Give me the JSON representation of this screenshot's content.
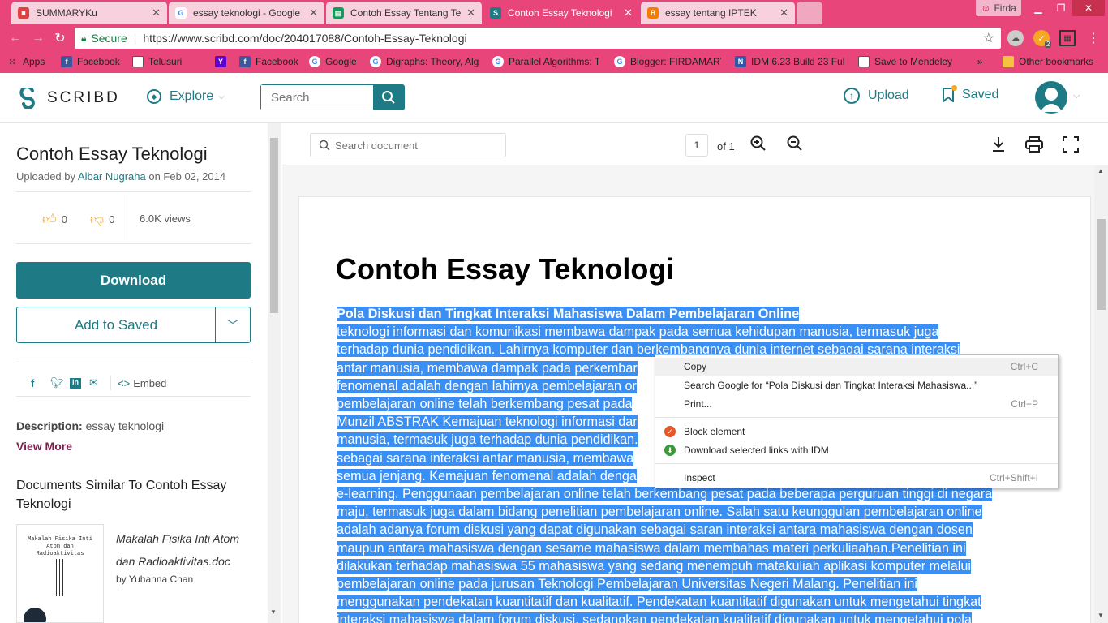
{
  "browser": {
    "tabs": [
      {
        "title": "SUMMARYKu",
        "favicon": "summary-icon",
        "active": false
      },
      {
        "title": "essay teknologi - Google",
        "favicon": "google-icon",
        "active": false
      },
      {
        "title": "Contoh Essay Tentang Te",
        "favicon": "google-sheets-icon",
        "active": false
      },
      {
        "title": "Contoh Essay Teknologi",
        "favicon": "scribd-icon",
        "active": true
      },
      {
        "title": "essay tentang IPTEK",
        "favicon": "blogger-icon",
        "active": false
      }
    ],
    "profile_name": "Firda",
    "secure_label": "Secure",
    "url": "https://www.scribd.com/doc/204017088/Contoh-Essay-Teknologi",
    "extension_badge": "2",
    "bookmarks": [
      {
        "label": "Apps",
        "icon": "apps-icon"
      },
      {
        "label": "Facebook",
        "icon": "facebook-icon"
      },
      {
        "label": "Telusuri",
        "icon": "page-icon"
      },
      {
        "label": "",
        "icon": "yahoo-icon"
      },
      {
        "label": "Facebook",
        "icon": "facebook-icon"
      },
      {
        "label": "Google",
        "icon": "google-icon"
      },
      {
        "label": "Digraphs: Theory, Alg",
        "icon": "google-icon"
      },
      {
        "label": "Parallel Algorithms: T",
        "icon": "google-icon"
      },
      {
        "label": "Blogger: FIRDAMARY",
        "icon": "google-icon"
      },
      {
        "label": "IDM 6.23 Build 23 Ful",
        "icon": "idm-icon"
      },
      {
        "label": "Save to Mendeley",
        "icon": "page-icon"
      }
    ],
    "more_bookmarks": "»",
    "other_bookmarks": "Other bookmarks"
  },
  "scribd": {
    "logo_text": "SCRIBD",
    "explore_label": "Explore",
    "search_placeholder": "Search",
    "upload_label": "Upload",
    "saved_label": "Saved"
  },
  "sidebar": {
    "title": "Contoh Essay Teknologi",
    "uploaded_prefix": "Uploaded by",
    "uploader": "Albar Nugraha",
    "uploaded_on": "on Feb 02, 2014",
    "likes": "0",
    "dislikes": "0",
    "views": "6.0K views",
    "download_label": "Download",
    "add_saved_label": "Add to Saved",
    "embed_label": "Embed",
    "description_label": "Description:",
    "description_value": "essay teknologi",
    "view_more": "View More",
    "similar_heading": "Documents Similar To Contoh Essay Teknologi",
    "similar_item": {
      "title": "Makalah Fisika Inti Atom dan Radioaktivitas.doc",
      "author": "by Yuhanna Chan",
      "thumb_title": "Makalah Fisika Inti Atom dan Radioaktivitas"
    }
  },
  "viewer": {
    "search_placeholder": "Search document",
    "page_number": "1",
    "page_total": "of 1",
    "doc_title": "Contoh Essay Teknologi",
    "lines": [
      "Pola Diskusi dan Tingkat Interaksi Mahasiswa Dalam Pembelajaran Online",
      " teknologi informasi dan komunikasi membawa dampak pada semua kehidupan manusia, termasuk juga",
      "terhadap dunia pendidikan. Lahirnya komputer dan berkembangnya dunia internet sebagai sarana interaksi",
      "antar manusia, membawa dampak pada perkembar",
      "fenomenal adalah dengan lahirnya pembelajaran or",
      "pembelajaran online telah berkembang pesat pada",
      "Munzil ABSTRAK Kemajuan teknologi informasi dar",
      "manusia, termasuk juga terhadap dunia pendidikan.",
      "sebagai sarana interaksi antar manusia, membawa",
      "semua jenjang. Kemajuan fenomenal adalah denga",
      "e-learning. Penggunaan pembelajaran online telah berkembang pesat pada beberapa perguruan tinggi di negara",
      "maju, termasuk juga dalam bidang penelitian pembelajaran online. Salah satu keunggulan pembelajaran online",
      "adalah adanya forum diskusi yang dapat digunakan sebagai saran interaksi antara mahasiswa dengan dosen",
      "maupun antara mahasiswa dengan sesame mahasiswa dalam membahas materi perkuliaahan.Penelitian ini",
      "dilakukan terhadap mahasiswa 55 mahasiswa yang sedang menempuh matakuliah aplikasi komputer melalui",
      "pembelajaran online pada jurusan Teknologi Pembelajaran Universitas Negeri Malang. Penelitian ini",
      "menggunakan pendekatan kuantitatif dan kualitatif. Pendekatan kuantitatif digunakan untuk mengetahui tingkat",
      "interaksi mahasiswa dalam forum diskusi, sedangkan pendekatan kualitatif digunakan untuk mengetahui pola"
    ]
  },
  "context_menu": {
    "items": [
      {
        "label": "Copy",
        "shortcut": "Ctrl+C"
      },
      {
        "label": "Search Google for “Pola Diskusi dan Tingkat Interaksi Mahasiswa...”",
        "shortcut": ""
      },
      {
        "label": "Print...",
        "shortcut": "Ctrl+P"
      },
      {
        "label": "Block element",
        "shortcut": ""
      },
      {
        "label": "Download selected links with IDM",
        "shortcut": ""
      },
      {
        "label": "Inspect",
        "shortcut": "Ctrl+Shift+I"
      }
    ]
  },
  "colors": {
    "browser_chrome": "#e8457a",
    "scribd_teal": "#1e7b85",
    "selection": "#3a8ff5",
    "link_purple": "#7a1f4a"
  }
}
